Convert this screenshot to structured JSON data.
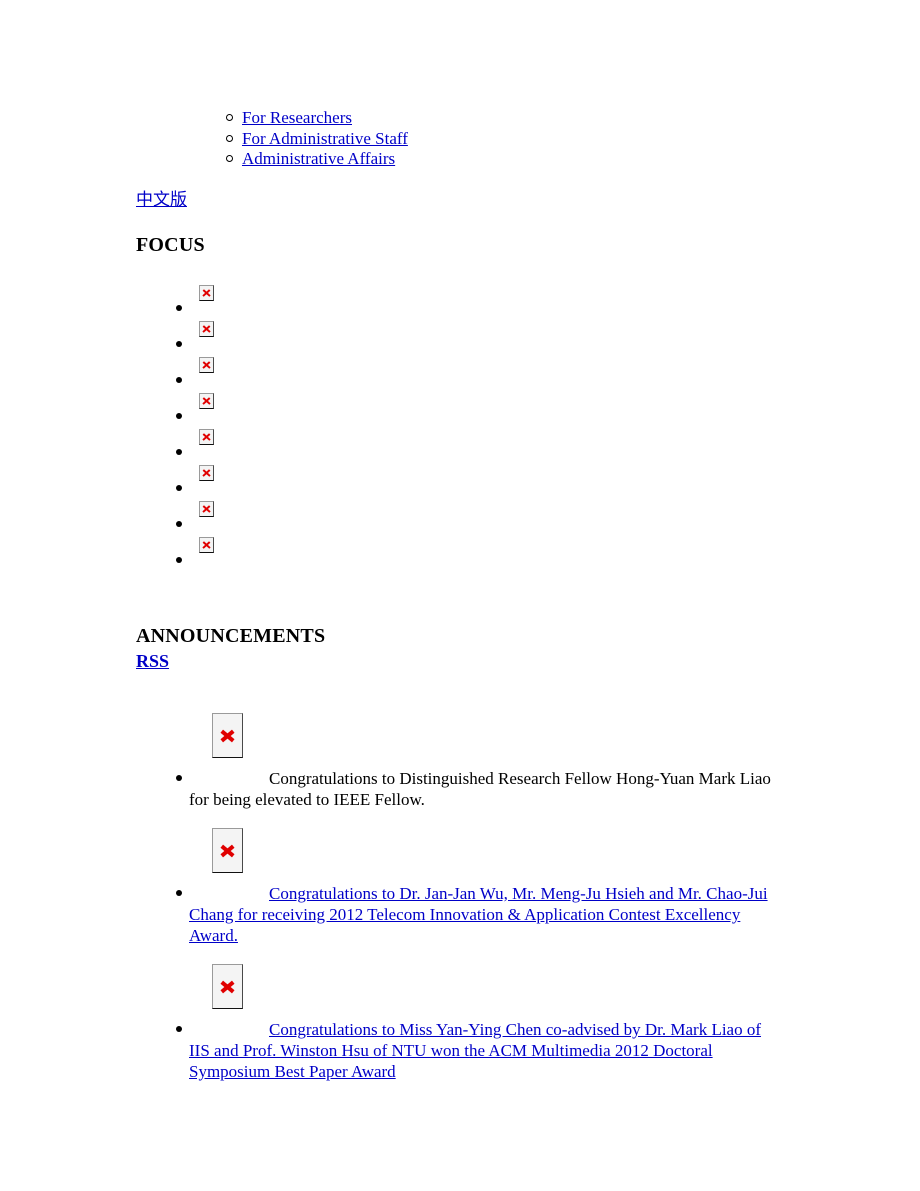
{
  "nav": {
    "items": [
      {
        "label": "For Researchers",
        "marker": "circle-marker"
      },
      {
        "label": "For Administrative Staff",
        "marker": "circle-marker"
      },
      {
        "label": "Administrative Affairs",
        "marker": "circle-marker"
      }
    ]
  },
  "language_link": {
    "label": "中文版"
  },
  "focus": {
    "heading": "FOCUS",
    "items": [
      {
        "icon": "broken-image-icon"
      },
      {
        "icon": "broken-image-icon"
      },
      {
        "icon": "broken-image-icon"
      },
      {
        "icon": "broken-image-icon"
      },
      {
        "icon": "broken-image-icon"
      },
      {
        "icon": "broken-image-icon"
      },
      {
        "icon": "broken-image-icon"
      },
      {
        "icon": "broken-image-icon"
      }
    ]
  },
  "announcements": {
    "heading": "ANNOUNCEMENTS",
    "rss_label": "RSS",
    "items": [
      {
        "icon": "broken-image-icon",
        "text": "Congratulations to Distinguished Research Fellow Hong-Yuan Mark Liao for being elevated to IEEE Fellow.",
        "is_link": false
      },
      {
        "icon": "broken-image-icon",
        "text": "Congratulations to Dr. Jan-Jan Wu, Mr. Meng-Ju Hsieh and Mr. Chao-Jui Chang for receiving 2012 Telecom Innovation & Application Contest Excellency Award.",
        "is_link": true
      },
      {
        "icon": "broken-image-icon",
        "text": "Congratulations to Miss Yan-Ying Chen co-advised by Dr. Mark Liao of IIS and Prof. Winston Hsu of NTU won the ACM Multimedia 2012 Doctoral Symposium Best Paper Award",
        "is_link": true
      }
    ]
  },
  "colors": {
    "link": "#0000c8",
    "text": "#000000",
    "background": "#ffffff",
    "broken_icon_x": "#e00000"
  }
}
